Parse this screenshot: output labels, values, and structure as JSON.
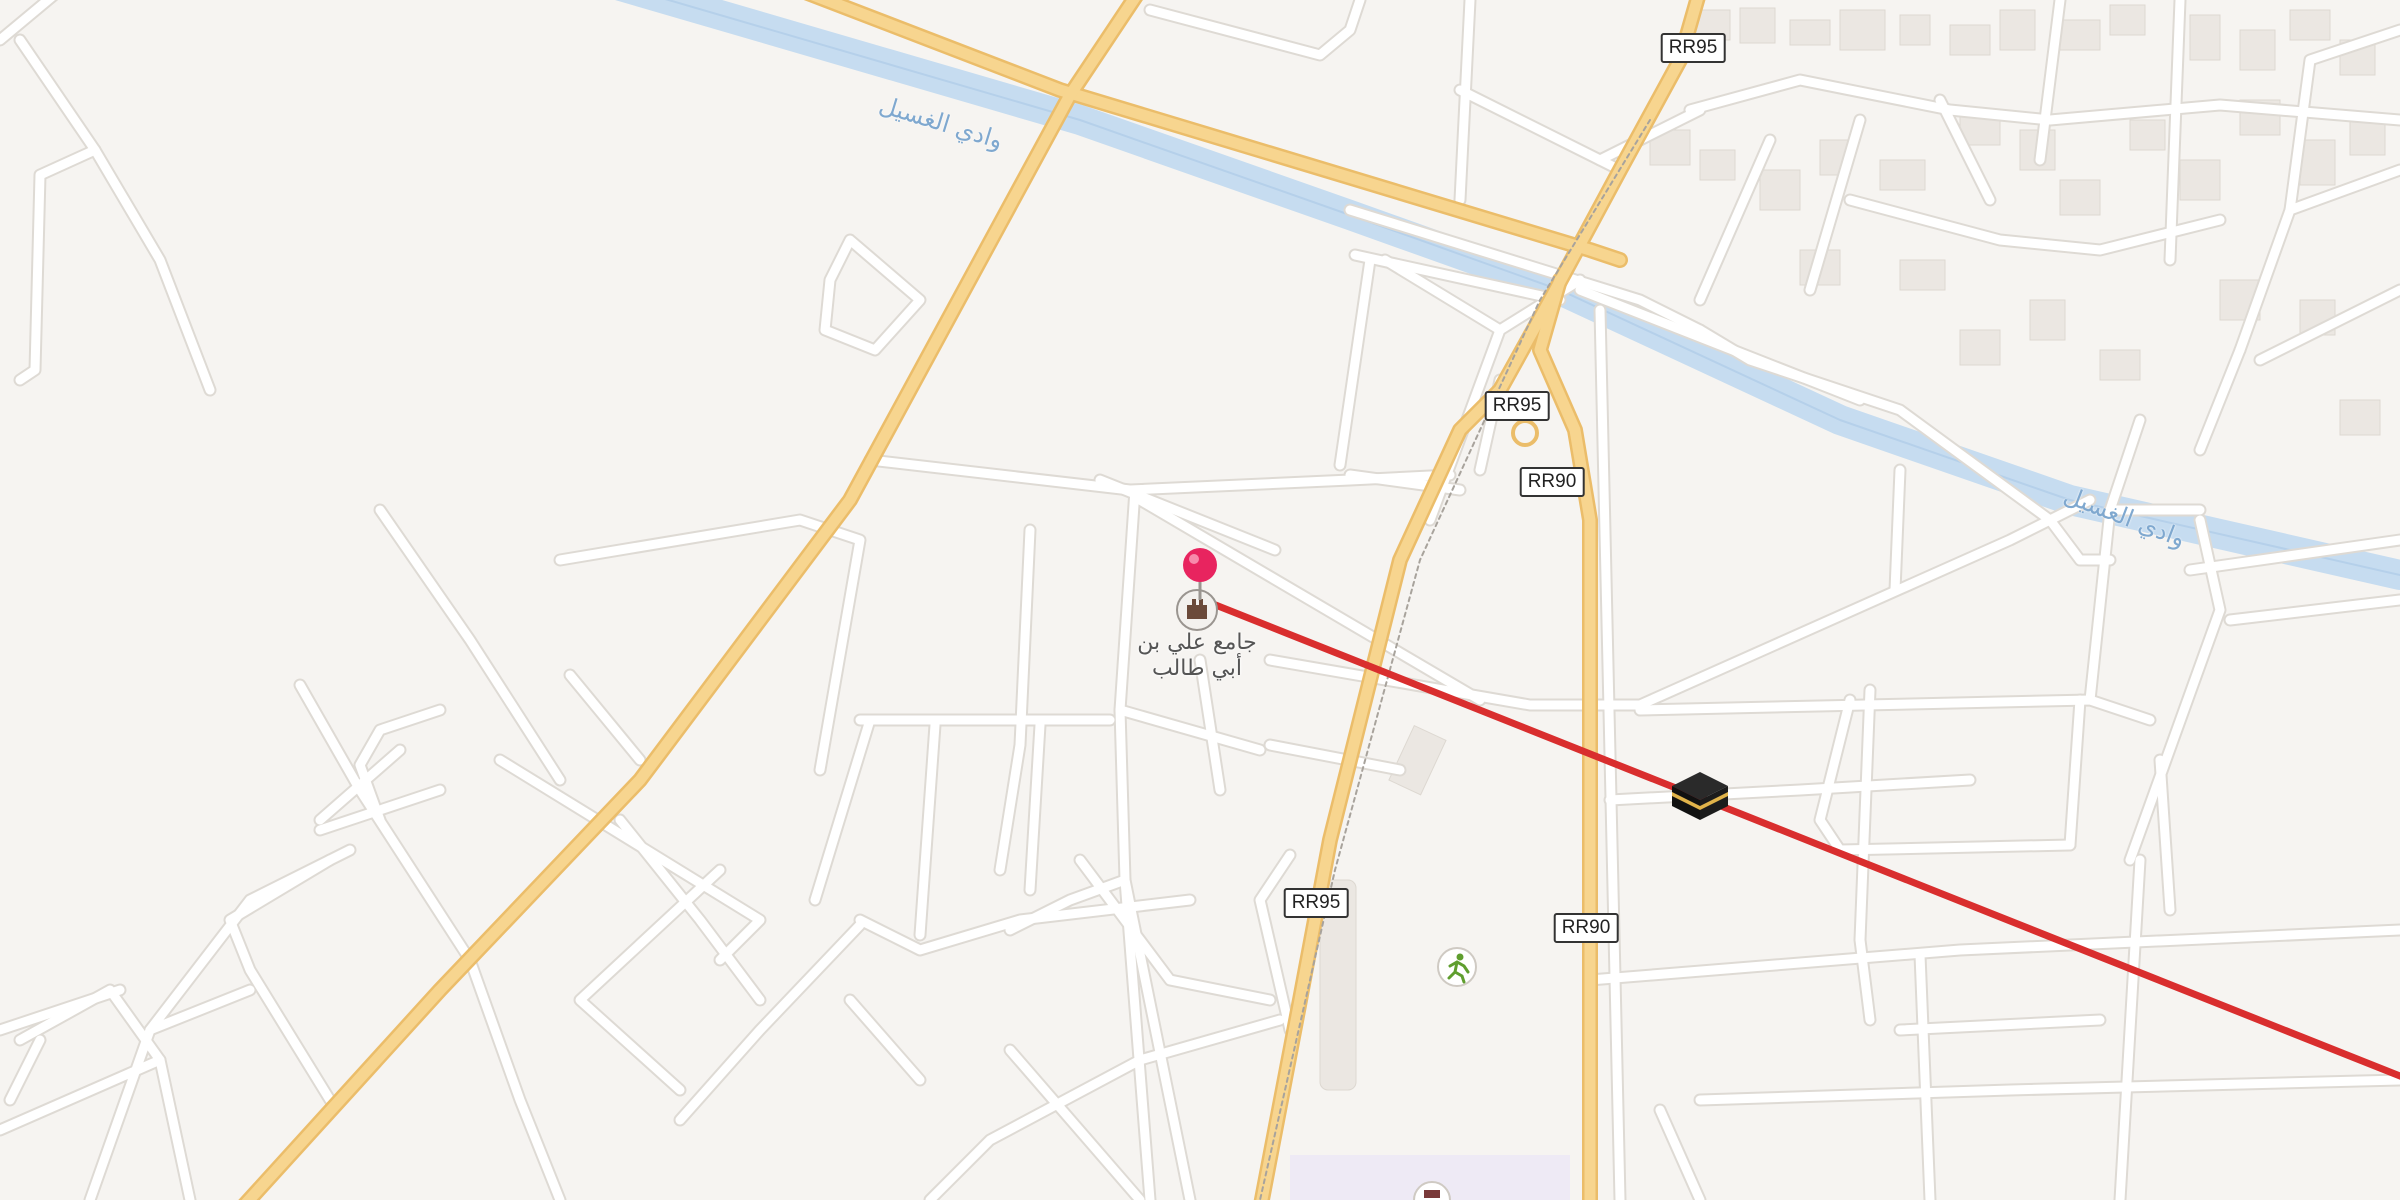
{
  "map": {
    "colors": {
      "background": "#f6f4f1",
      "water": "#c6dcf0",
      "highway": "#f7d58f",
      "highway_casing": "#ebbd6a",
      "street": "#ffffff",
      "street_casing": "#dedad4",
      "building": "#ebe7e2",
      "direction_line": "#d92e2e",
      "pin": "#e8245f"
    },
    "water_labels": [
      "وادي الغسيل",
      "وادي الغسيل"
    ],
    "road_shields": [
      "RR95",
      "RR95",
      "RR90",
      "RR95",
      "RR90"
    ],
    "poi": {
      "icon": "mosque-icon",
      "label_line1": "جامع علي بن",
      "label_line2": "أبي طالب"
    },
    "markers": [
      "location-pin",
      "kaaba-icon",
      "park-icon",
      "school-icon"
    ]
  }
}
